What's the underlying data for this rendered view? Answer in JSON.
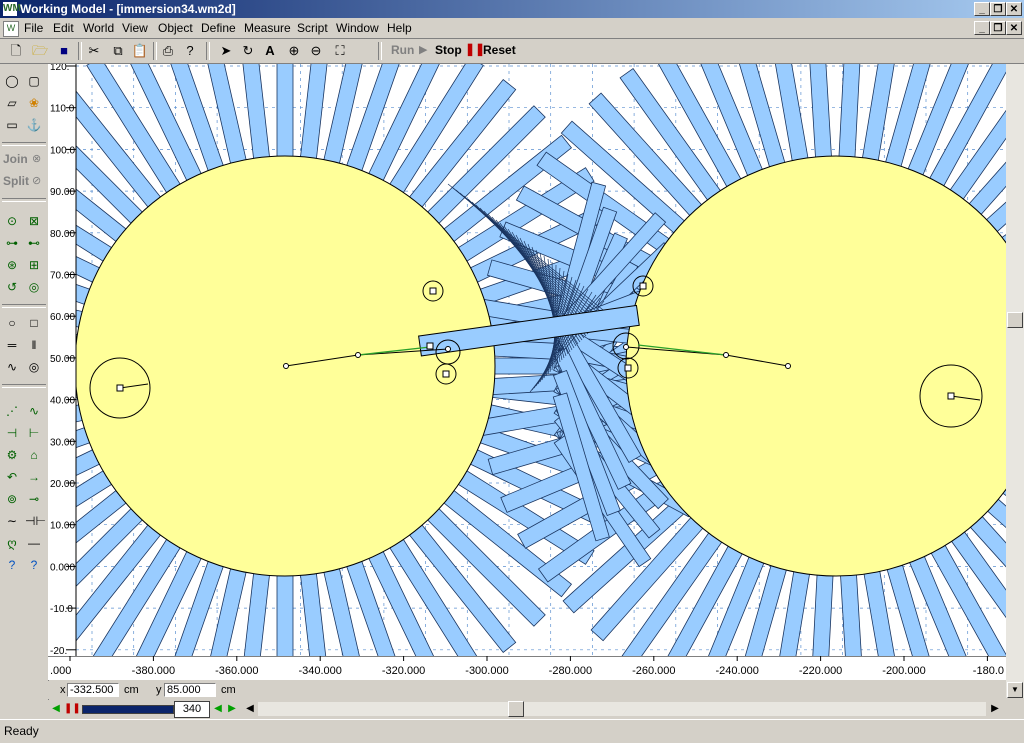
{
  "window": {
    "title": "Working Model - [immersion34.wm2d]",
    "app_icon": "working-model-icon",
    "caption_buttons": [
      "_",
      "❐",
      "✕"
    ]
  },
  "menu": {
    "items": [
      "File",
      "Edit",
      "World",
      "View",
      "Object",
      "Define",
      "Measure",
      "Script",
      "Window",
      "Help"
    ]
  },
  "toolbar": {
    "run_label": "Run",
    "stop_label": "Stop",
    "reset_label": "Reset"
  },
  "left_tools": {
    "join_label": "Join",
    "split_label": "Split"
  },
  "ruler": {
    "y_ticks": [
      "120.",
      "110.0",
      "100.0",
      "90.00",
      "80.00",
      "70.00",
      "60.00",
      "50.00",
      "40.00",
      "30.00",
      "20.00",
      "10.00",
      "0.000",
      "-10.0",
      "-20."
    ],
    "x_ticks": [
      ".000",
      "-380.000",
      "-360.000",
      "-340.000",
      "-320.000",
      "-300.000",
      "-280.000",
      "-260.000",
      "-240.000",
      "-220.000",
      "-200.000",
      "-180.0"
    ]
  },
  "coords": {
    "x_label": "x",
    "x_value": "-332.500",
    "x_unit": "cm",
    "y_label": "y",
    "y_value": "85.000",
    "y_unit": "cm"
  },
  "playback": {
    "frame": "340"
  },
  "status": {
    "text": "Ready"
  },
  "colors": {
    "wheel_fill": "#ffff99",
    "spoke_fill": "#99ccff",
    "spoke_stroke": "#1a3560",
    "grid": "#5a8fd0",
    "link_green": "#2aa02a"
  }
}
